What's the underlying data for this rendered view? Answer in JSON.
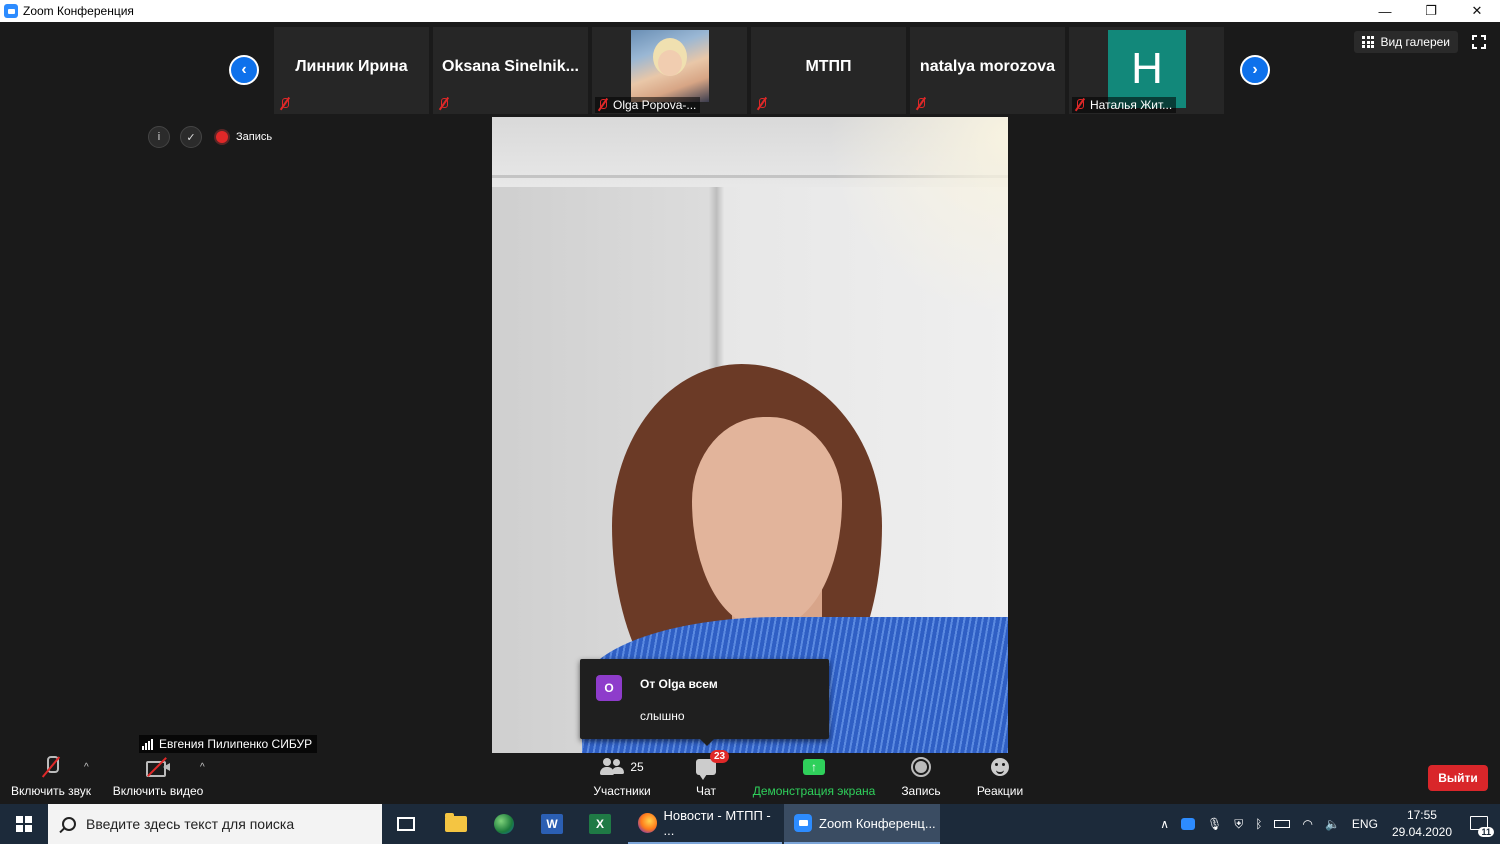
{
  "window": {
    "title": "Zoom Конференция",
    "controls": {
      "minimize": "—",
      "restore": "❐",
      "close": "✕"
    }
  },
  "thumbnails": [
    {
      "name": "Линник Ирина",
      "label": "",
      "muted": true,
      "kind": "name"
    },
    {
      "name": "Oksana  Sinelnik...",
      "label": "",
      "muted": true,
      "kind": "name"
    },
    {
      "name": "",
      "label": "Olga Popova-...",
      "muted": true,
      "kind": "photo"
    },
    {
      "name": "МТПП",
      "label": "",
      "muted": true,
      "kind": "name"
    },
    {
      "name": "natalya morozova",
      "label": "",
      "muted": true,
      "kind": "name"
    },
    {
      "name": "H",
      "label": "Наталья Жит...",
      "muted": true,
      "kind": "letter"
    }
  ],
  "nav": {
    "prev": "‹",
    "next": "›"
  },
  "view": {
    "gallery_label": "Вид галереи"
  },
  "meeting_info": {
    "info_icon": "i",
    "recording_label": "Запись"
  },
  "speaker": {
    "name": "Евгения Пилипенко СИБУР"
  },
  "chat_popup": {
    "avatar_letter": "O",
    "from": "От Olga всем",
    "message": "слышно"
  },
  "toolbar": {
    "audio_label": "Включить звук",
    "video_label": "Включить видео",
    "participants_label": "Участники",
    "participants_count": "25",
    "chat_label": "Чат",
    "chat_badge": "23",
    "share_label": "Демонстрация экрана",
    "record_label": "Запись",
    "reactions_label": "Реакции",
    "leave_label": "Выйти",
    "caret": "^"
  },
  "taskbar": {
    "search_placeholder": "Введите здесь текст для поиска",
    "word_letter": "W",
    "excel_letter": "X",
    "firefox_label": "Новости - МТПП - ...",
    "zoom_label": "Zoom Конференц...",
    "language": "ENG",
    "time": "17:55",
    "date": "29.04.2020",
    "notification_count": "11"
  },
  "colors": {
    "zoom_blue": "#2d8cff",
    "share_green": "#2fd05b",
    "leave_red": "#d9262a",
    "muted_red": "#e02828",
    "taskbar": "#1c2a3a"
  }
}
